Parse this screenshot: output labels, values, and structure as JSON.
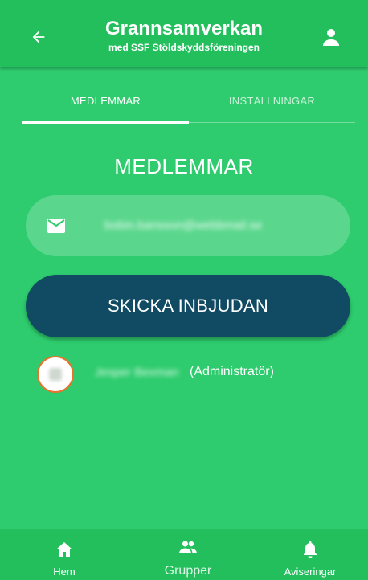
{
  "header": {
    "title": "Grannsamverkan",
    "subtitle": "med SSF Stöldskyddsföreningen"
  },
  "tabs": [
    {
      "label": "MEDLEMMAR",
      "active": true
    },
    {
      "label": "INSTÄLLNINGAR",
      "active": false
    }
  ],
  "members_section": {
    "title": "MEDLEMMAR",
    "email_value": "bobin.bansson@webbmail.se",
    "invite_button_label": "SKICKA INBJUDAN"
  },
  "members": [
    {
      "name": "Jesper Bexman",
      "role": "(Administratör)"
    }
  ],
  "bottom_nav": {
    "home": "Hem",
    "groups": "Grupper",
    "notifications": "Aviseringar"
  },
  "colors": {
    "background": "#2ecc6e",
    "header": "#22bf5c",
    "button": "#114b63",
    "avatar_border": "#e8732c"
  }
}
